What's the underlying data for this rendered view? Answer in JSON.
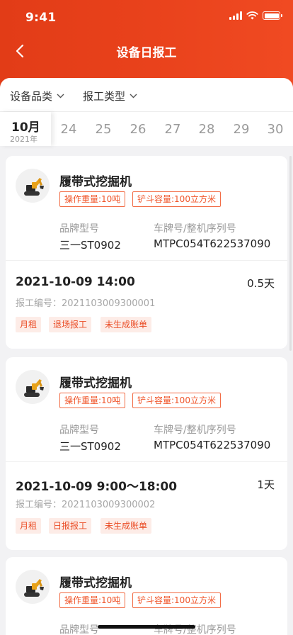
{
  "status_bar": {
    "time": "9:41"
  },
  "nav": {
    "title": "设备日报工",
    "back_icon": "chevron-left-icon"
  },
  "filters": [
    {
      "label": "设备品类"
    },
    {
      "label": "报工类型"
    }
  ],
  "date_strip": {
    "month": "10月",
    "year": "2021年",
    "days": [
      "24",
      "25",
      "26",
      "27",
      "28",
      "29",
      "30"
    ]
  },
  "cards": [
    {
      "equipment_name": "履带式挖掘机",
      "tag_weight": "操作重量:10吨",
      "tag_bucket": "铲斗容量:100立方米",
      "brand_label": "品牌型号",
      "brand_value": "三一ST0902",
      "plate_label": "车牌号/整机序列号",
      "plate_value": "MTPC054T622537090",
      "report_time": "2021-10-09 14:00",
      "duration": "0.5天",
      "report_no": "报工编号：2021103009300001",
      "tags": [
        "月租",
        "退场报工",
        "未生成账单"
      ]
    },
    {
      "equipment_name": "履带式挖掘机",
      "tag_weight": "操作重量:10吨",
      "tag_bucket": "铲斗容量:100立方米",
      "brand_label": "品牌型号",
      "brand_value": "三一ST0902",
      "plate_label": "车牌号/整机序列号",
      "plate_value": "MTPC054T622537090",
      "report_time": "2021-10-09 9:00～18:00",
      "duration": "1天",
      "report_no": "报工编号：2021103009300002",
      "tags": [
        "月租",
        "日报报工",
        "未生成账单"
      ]
    },
    {
      "equipment_name": "履带式挖掘机",
      "tag_weight": "操作重量:10吨",
      "tag_bucket": "铲斗容量:100立方米",
      "brand_label": "品牌型号",
      "plate_label": "车牌号/整机序列号"
    }
  ],
  "colors": {
    "header": "#e8411b",
    "accent": "#f0552a",
    "tag_bg": "#fdece7"
  }
}
